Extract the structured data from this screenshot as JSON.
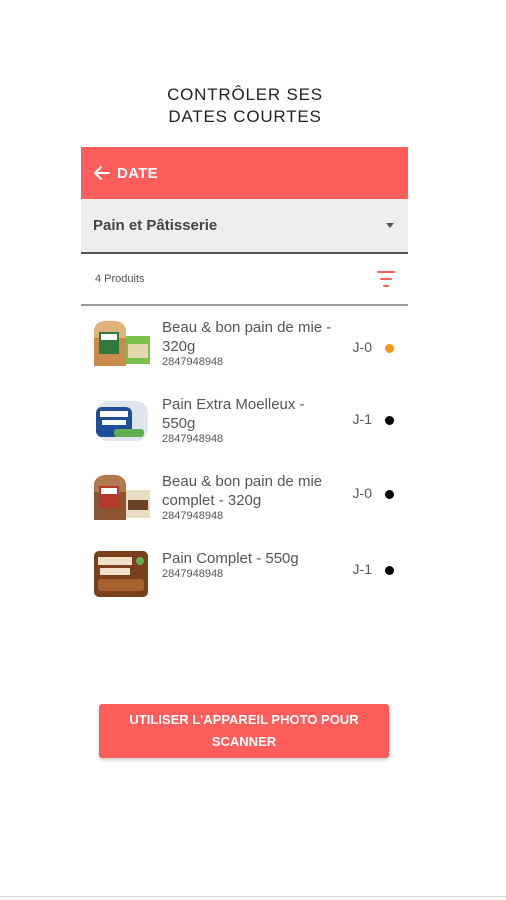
{
  "page_title": {
    "line1": "CONTRÔLER SES",
    "line2": "DATES COURTES"
  },
  "appbar": {
    "back_icon": "arrow-left-icon",
    "title": "DATE",
    "background": "#fe5e5b"
  },
  "category": {
    "selected": "Pain et Pâtisserie",
    "icon": "dropdown-caret-icon"
  },
  "list_header": {
    "count": "4 Produits",
    "filter_icon": "filter-icon"
  },
  "products": [
    {
      "name_line1": "Beau & bon pain de mie -",
      "name_line2": "320g",
      "code": "2847948948",
      "days": "J-0",
      "status_color": "#f7931e"
    },
    {
      "name_line1": "Pain Extra Moelleux  -",
      "name_line2": "550g",
      "code": "2847948948",
      "days": "J-1",
      "status_color": "#000000"
    },
    {
      "name_line1": "Beau & bon pain de mie",
      "name_line2": "complet - 320g",
      "code": "2847948948",
      "days": "J-0",
      "status_color": "#000000"
    },
    {
      "name_line1": "Pain Complet - 550g",
      "name_line2": "",
      "code": "2847948948",
      "days": "J-1",
      "status_color": "#000000"
    }
  ],
  "scan_button": {
    "line1": "UTILISER L'APPAREIL PHOTO POUR",
    "line2": "SCANNER"
  }
}
